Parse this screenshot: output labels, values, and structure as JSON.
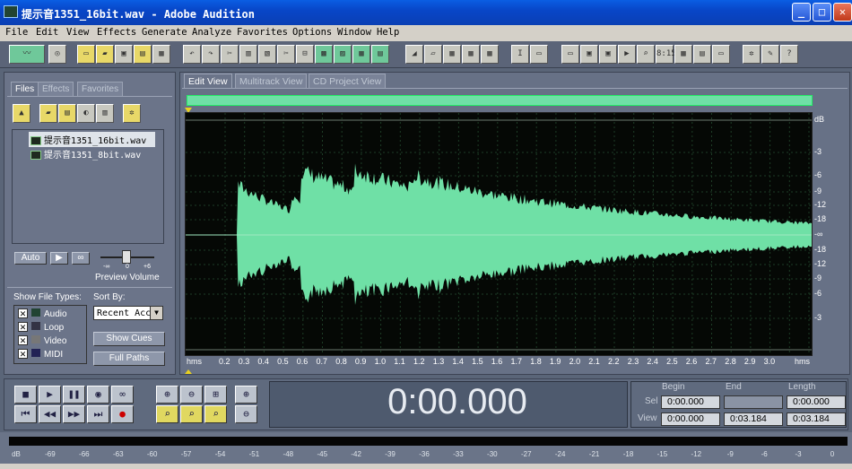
{
  "window": {
    "title": "提示音1351_16bit.wav - Adobe Audition"
  },
  "menu": [
    "File",
    "Edit",
    "View",
    "Effects",
    "Generate",
    "Analyze",
    "Favorites",
    "Options",
    "Window",
    "Help"
  ],
  "left_panel": {
    "tabs": [
      "Files",
      "Effects",
      "Favorites"
    ],
    "files": [
      "提示音1351_16bit.wav",
      "提示音1351_8bit.wav"
    ],
    "auto_label": "Auto",
    "preview_volume_label": "Preview Volume",
    "slider_ticks": [
      "-∞",
      "0",
      "+6"
    ],
    "show_file_types_label": "Show File Types:",
    "file_types": [
      {
        "label": "Audio",
        "checked": true
      },
      {
        "label": "Loop",
        "checked": true
      },
      {
        "label": "Video",
        "checked": true
      },
      {
        "label": "MIDI",
        "checked": true
      }
    ],
    "sort_by_label": "Sort By:",
    "sort_by_value": "Recent Acc",
    "show_cues_label": "Show Cues",
    "full_paths_label": "Full Paths"
  },
  "editor": {
    "tabs": [
      "Edit View",
      "Multitrack View",
      "CD Project View"
    ],
    "db_labels": [
      "dB",
      "-3",
      "-6",
      "-9",
      "-12",
      "-18",
      "-∞",
      "-18",
      "-12",
      "-9",
      "-6",
      "-3"
    ],
    "time_ticks": [
      "hms",
      "0.2",
      "0.3",
      "0.4",
      "0.5",
      "0.6",
      "0.7",
      "0.8",
      "0.9",
      "1.0",
      "1.1",
      "1.2",
      "1.3",
      "1.4",
      "1.5",
      "1.6",
      "1.7",
      "1.8",
      "1.9",
      "2.0",
      "2.1",
      "2.2",
      "2.3",
      "2.4",
      "2.5",
      "2.6",
      "2.7",
      "2.8",
      "2.9",
      "3.0",
      "hms"
    ]
  },
  "transport": {
    "time_display": "0:00.000",
    "headers": [
      "Begin",
      "End",
      "Length"
    ],
    "sel_label": "Sel",
    "view_label": "View",
    "sel": {
      "begin": "0:00.000",
      "end": "",
      "length": "0:00.000"
    },
    "view": {
      "begin": "0:00.000",
      "end": "0:03.184",
      "length": "0:03.184"
    }
  },
  "level_meter": {
    "labels": [
      "dB",
      "-69",
      "-66",
      "-63",
      "-60",
      "-57",
      "-54",
      "-51",
      "-48",
      "-45",
      "-42",
      "-39",
      "-36",
      "-33",
      "-30",
      "-27",
      "-24",
      "-21",
      "-18",
      "-15",
      "-12",
      "-9",
      "-6",
      "-3",
      "0"
    ]
  },
  "colors": {
    "waveform": "#6fe0a6",
    "waveform_bg": "#050805",
    "title_bar": "#0a5ee3",
    "panel": "#677186"
  }
}
